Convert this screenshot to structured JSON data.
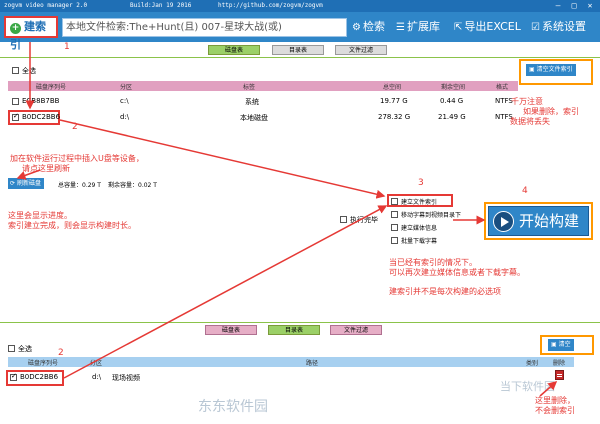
{
  "window": {
    "app": "zogvm video manager 2.0",
    "build": "Build:Jan 19 2016",
    "url": "http://github.com/zogvm/zogvm"
  },
  "toolbar": {
    "build_index": "建索引",
    "search_value": "本地文件检索:The+Hunt(且) 007-星球大战(或)",
    "search_btn": "检索",
    "extensions": "扩展库",
    "export_excel": "导出EXCEL",
    "settings": "系统设置"
  },
  "top_tabs": [
    "磁盘表",
    "目录表",
    "文件过滤"
  ],
  "disk_panel": {
    "select_all": "全选",
    "clear_index": "清空文件索引",
    "headers": [
      "磁盘序列号",
      "分区",
      "标签",
      "总空间",
      "剩余空间",
      "格式"
    ],
    "rows": [
      {
        "serial": "ECB8B7BB",
        "partition": "c:\\",
        "label": "系统",
        "total": "19.77 G",
        "free": "0.44 G",
        "format": "NTFS",
        "checked": false
      },
      {
        "serial": "B0DC2BB6",
        "partition": "d:\\",
        "label": "本地磁盘",
        "total": "278.32 G",
        "free": "21.49 G",
        "format": "NTFS",
        "checked": true
      }
    ],
    "refresh": "刷新磁盘",
    "total_capacity": "总容量：0.29 T",
    "free_capacity": "剩余容量：0.02 T"
  },
  "options": {
    "exec": "执行完毕",
    "items": [
      "建立文件索引",
      "移动字幕到视频目录下",
      "建立媒体信息",
      "批量下载字幕"
    ]
  },
  "start_button": "开始构建",
  "bottom_tabs": [
    "磁盘表",
    "目录表",
    "文件过滤"
  ],
  "dir_panel": {
    "select_all": "全选",
    "clear": "清空",
    "headers": [
      "磁盘序列号",
      "分区",
      "路径",
      "类别",
      "删除"
    ],
    "rows": [
      {
        "serial": "B0DC2BB6",
        "partition": "d:\\",
        "path": "现场视频",
        "checked": true
      }
    ]
  },
  "annotations": {
    "n1": "1",
    "n2a": "2",
    "n2b": "2",
    "n3": "3",
    "n4": "4",
    "warn1": "千万注意",
    "warn2": "如果删除，索引",
    "warn3": "数据将丢失",
    "usb1": "加在软件运行过程中插入U盘等设备，",
    "usb2": "请点这里刷新",
    "progress1": "这里会显示进度。",
    "progress2": "索引建立完成，则会显示构建时长。",
    "note1": "当已经有索引的情况下。",
    "note2": "可以再次建立媒体信息或者下载字幕。",
    "note3": "建索引并不是每次构建的必选项",
    "del1": "这里删除，",
    "del2": "不会删索引"
  },
  "watermarks": {
    "left": "东东软件园",
    "right": "当下软件园"
  },
  "colors": {
    "toolbar": "#2f86c8",
    "annotation": "#e53935",
    "highlight": "#ff9800"
  }
}
